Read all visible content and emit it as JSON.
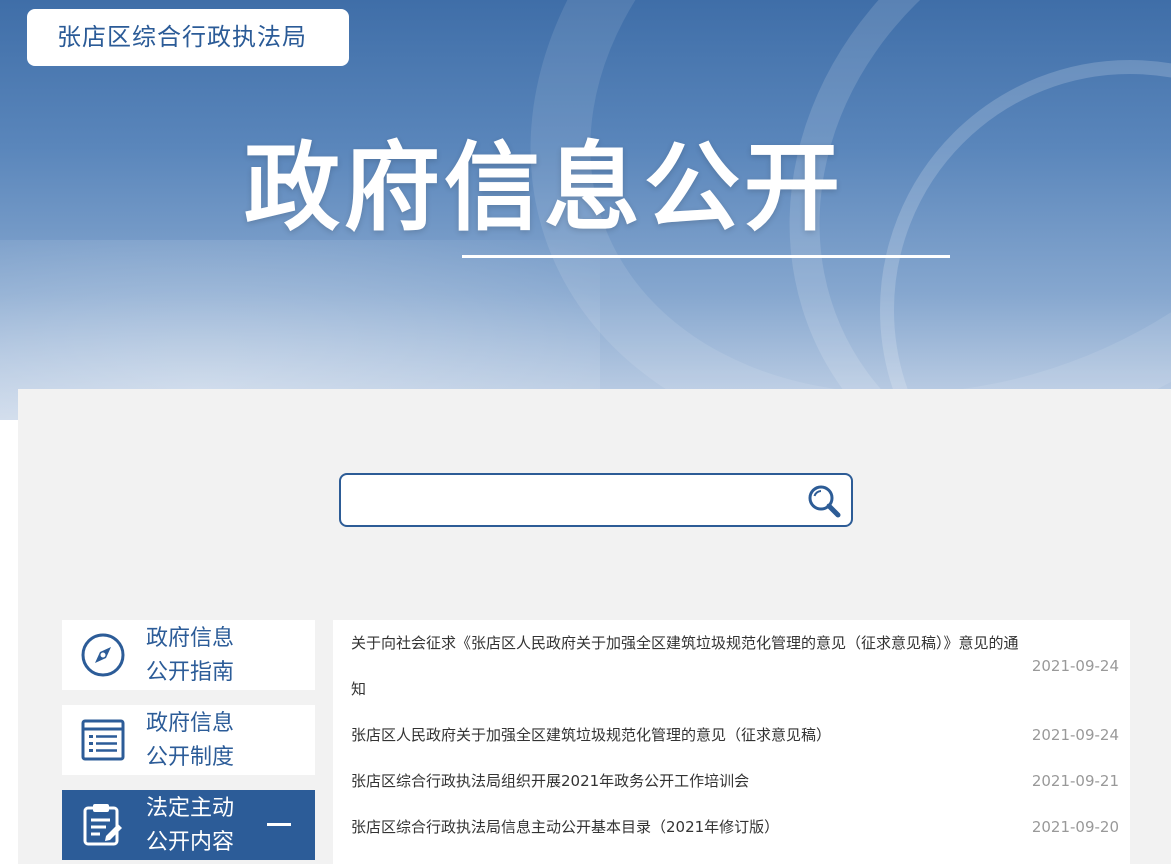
{
  "header": {
    "org_name": "张店区综合行政执法局",
    "page_title": "政府信息公开"
  },
  "search": {
    "placeholder": "",
    "value": ""
  },
  "sidebar": {
    "items": [
      {
        "label_line1": "政府信息",
        "label_line2": "公开指南",
        "icon": "compass-icon",
        "active": false
      },
      {
        "label_line1": "政府信息",
        "label_line2": "公开制度",
        "icon": "list-icon",
        "active": false
      },
      {
        "label_line1": "法定主动",
        "label_line2": "公开内容",
        "icon": "clipboard-edit-icon",
        "active": true
      }
    ]
  },
  "news": {
    "items": [
      {
        "title": "关于向社会征求《张店区人民政府关于加强全区建筑垃圾规范化管理的意见（征求意见稿）》意见的通知",
        "date": "2021-09-24"
      },
      {
        "title": "张店区人民政府关于加强全区建筑垃圾规范化管理的意见（征求意见稿）",
        "date": "2021-09-24"
      },
      {
        "title": "张店区综合行政执法局组织开展2021年政务公开工作培训会",
        "date": "2021-09-21"
      },
      {
        "title": "张店区综合行政执法局信息主动公开基本目录（2021年修订版）",
        "date": "2021-09-20"
      }
    ]
  },
  "colors": {
    "brand_blue": "#2c5c98",
    "panel_gray": "#f2f2f2",
    "date_gray": "#999999"
  }
}
